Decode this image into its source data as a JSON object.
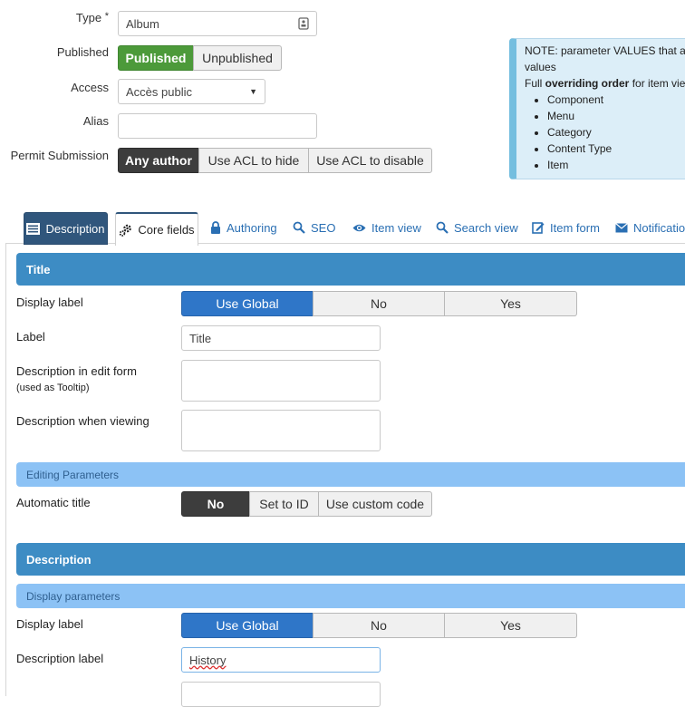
{
  "form": {
    "type": {
      "label": "Type",
      "required_mark": "*",
      "value": "Album"
    },
    "published": {
      "label": "Published",
      "options": [
        "Published",
        "Unpublished"
      ],
      "selected": "Published"
    },
    "access": {
      "label": "Access",
      "value": "Accès public"
    },
    "alias": {
      "label": "Alias",
      "value": ""
    },
    "permit_submission": {
      "label": "Permit Submission",
      "options": [
        "Any author",
        "Use ACL to hide",
        "Use ACL to disable"
      ],
      "selected": "Any author"
    }
  },
  "note": {
    "line1": "NOTE: parameter VALUES that a",
    "line2": "values",
    "line3_prefix": "Full ",
    "line3_bold": "overriding order",
    "line3_suffix": " for item vie",
    "items": [
      "Component",
      "Menu",
      "Category",
      "Content Type",
      "Item"
    ]
  },
  "tabs": [
    {
      "label": "Description",
      "icon": "list-icon",
      "active": false
    },
    {
      "label": "Core fields",
      "icon": "gears-icon",
      "active": true
    },
    {
      "label": "Authoring",
      "icon": "lock-icon"
    },
    {
      "label": "SEO",
      "icon": "search-icon"
    },
    {
      "label": "Item view",
      "icon": "eye-icon"
    },
    {
      "label": "Search view",
      "icon": "search-icon"
    },
    {
      "label": "Item form",
      "icon": "edit-icon"
    },
    {
      "label": "Notification",
      "icon": "envelope-icon"
    }
  ],
  "sections": {
    "title": {
      "header": "Title",
      "display_label": {
        "label": "Display label",
        "options": [
          "Use Global",
          "No",
          "Yes"
        ],
        "selected": "Use Global"
      },
      "label_field": {
        "label": "Label",
        "value": "Title"
      },
      "desc_edit": {
        "label": "Description in edit form",
        "sublabel": "(used as Tooltip)",
        "value": ""
      },
      "desc_view": {
        "label": "Description when viewing",
        "value": ""
      },
      "editing_params": "Editing Parameters",
      "automatic_title": {
        "label": "Automatic title",
        "options": [
          "No",
          "Set to ID",
          "Use custom code"
        ],
        "selected": "No"
      }
    },
    "description": {
      "header": "Description",
      "display_params": "Display parameters",
      "display_label": {
        "label": "Display label",
        "options": [
          "Use Global",
          "No",
          "Yes"
        ],
        "selected": "Use Global"
      },
      "desc_label": {
        "label": "Description label",
        "value": "History"
      }
    }
  },
  "colors": {
    "green": "#4c9a3a",
    "dark": "#3d3d3d",
    "blue": "#2f76c8",
    "section_header": "#3d8cc4",
    "subsection": "#8cc2f5",
    "tab_active": "#30567c"
  }
}
